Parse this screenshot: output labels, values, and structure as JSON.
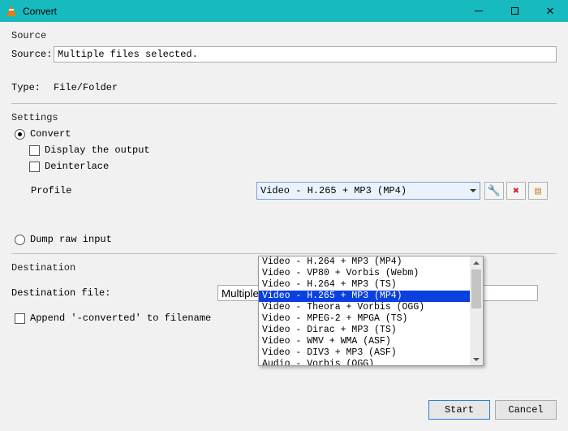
{
  "window": {
    "title": "Convert"
  },
  "source": {
    "heading": "Source",
    "source_label": "Source:",
    "source_value": "Multiple files selected.",
    "type_label": "Type:",
    "type_value": "File/Folder"
  },
  "settings": {
    "heading": "Settings",
    "convert_label": "Convert",
    "display_output_label": "Display the output",
    "deinterlace_label": "Deinterlace",
    "profile_label": "Profile",
    "profile_selected": "Video - H.265 + MP3 (MP4)",
    "dump_raw_label": "Dump raw input",
    "profile_options": [
      "Video - H.264 + MP3 (MP4)",
      "Video - VP80 + Vorbis (Webm)",
      "Video - H.264 + MP3 (TS)",
      "Video - H.265 + MP3 (MP4)",
      "Video - Theora + Vorbis (OGG)",
      "Video - MPEG-2 + MPGA (TS)",
      "Video - Dirac + MP3 (TS)",
      "Video - WMV + WMA (ASF)",
      "Video - DIV3 + MP3 (ASF)",
      "Audio - Vorbis (OGG)"
    ],
    "profile_highlight_index": 3
  },
  "destination": {
    "heading": "Destination",
    "file_label": "Destination file:",
    "file_value": "Multiple Fil",
    "append_label": "Append '-converted' to filename"
  },
  "buttons": {
    "start": "Start",
    "cancel": "Cancel"
  },
  "icons": {
    "edit": "🔧",
    "delete": "✖",
    "new": "▤"
  }
}
